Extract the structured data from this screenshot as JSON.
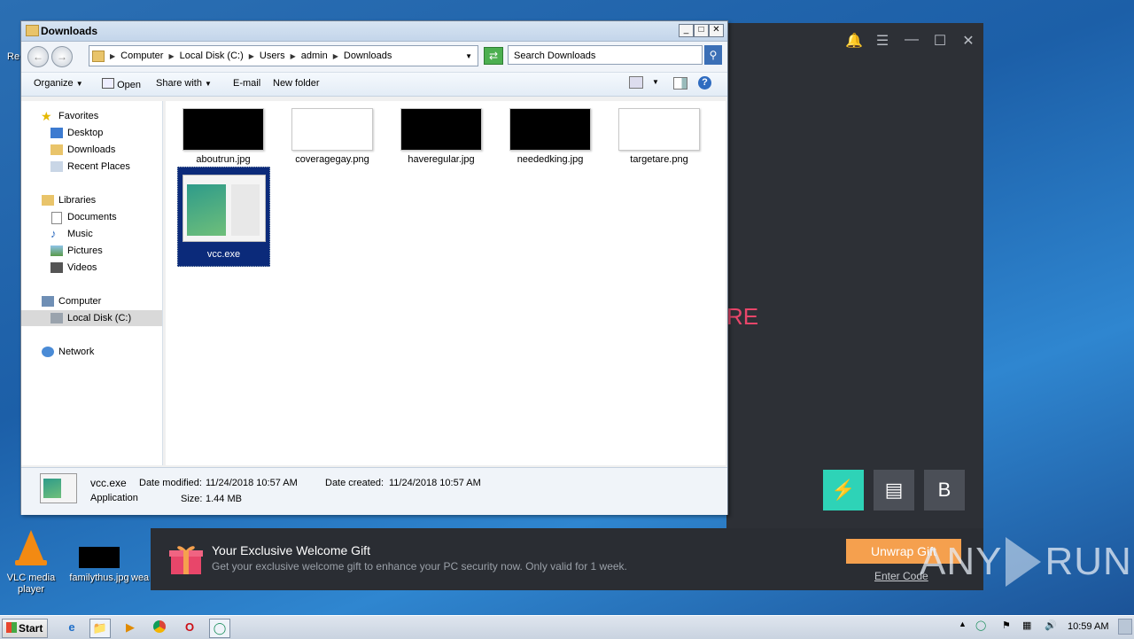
{
  "desktop": {
    "icons": [
      {
        "label": "VLC media player"
      },
      {
        "label": "familythus.jpg"
      },
      {
        "label": "wea"
      }
    ],
    "left_edge_fragment": "Re"
  },
  "security_app": {
    "bell_icon": "bell-icon",
    "menu_icon": "menu-icon",
    "visible_text_fragment": "RE",
    "tile_b_label": "B",
    "colors": {
      "bg": "#2d3036",
      "accent": "#2ed3b7",
      "pink": "#e8466a",
      "orange": "#f5a04e"
    }
  },
  "gift_bar": {
    "title": "Your Exclusive Welcome Gift",
    "subtitle": "Get your exclusive welcome gift to enhance your PC security now. Only valid for 1 week.",
    "button_label": "Unwrap Gift",
    "link_label": "Enter Code"
  },
  "watermark": {
    "text_any": "ANY",
    "text_run": "RUN"
  },
  "explorer": {
    "title": "Downloads",
    "breadcrumbs": [
      "Computer",
      "Local Disk (C:)",
      "Users",
      "admin",
      "Downloads"
    ],
    "search_placeholder": "Search Downloads",
    "toolbar": {
      "organize": "Organize",
      "open": "Open",
      "share_with": "Share with",
      "email": "E-mail",
      "new_folder": "New folder"
    },
    "nav": {
      "favorites": "Favorites",
      "desktop": "Desktop",
      "downloads": "Downloads",
      "recent_places": "Recent Places",
      "libraries": "Libraries",
      "documents": "Documents",
      "music": "Music",
      "pictures": "Pictures",
      "videos": "Videos",
      "computer": "Computer",
      "local_disk": "Local Disk (C:)",
      "network": "Network"
    },
    "files": [
      {
        "name": "aboutrun.jpg"
      },
      {
        "name": "coveragegay.png"
      },
      {
        "name": "haveregular.jpg"
      },
      {
        "name": "neededking.jpg"
      },
      {
        "name": "targetare.png"
      },
      {
        "name": "vcc.exe"
      }
    ],
    "details": {
      "name": "vcc.exe",
      "type": "Application",
      "modified_label": "Date modified:",
      "modified_value": "11/24/2018 10:57 AM",
      "created_label": "Date created:",
      "created_value": "11/24/2018 10:57 AM",
      "size_label": "Size:",
      "size_value": "1.44 MB"
    }
  },
  "taskbar": {
    "start_label": "Start",
    "clock": "10:59 AM"
  }
}
